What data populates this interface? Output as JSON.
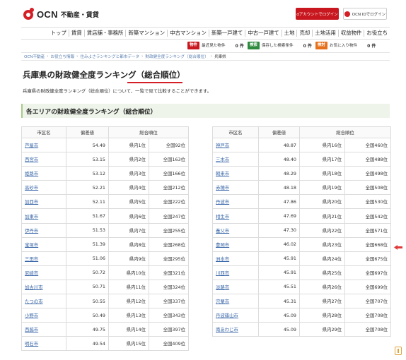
{
  "header": {
    "logo_text": "OCN",
    "logo_sub": "不動産・賃貸",
    "login_d": "dアカウントでログイン",
    "login_ocn": "OCN IDでログイン"
  },
  "nav": [
    "トップ",
    "賃貸",
    "賃店舗・事務所",
    "新築マンション",
    "中古マンション",
    "新築一戸建て",
    "中古一戸建て",
    "土地",
    "売却",
    "土地活用",
    "収益物件",
    "お役立ち"
  ],
  "tools": [
    {
      "tag": "物件",
      "label": "最近見た物件",
      "count": "0 件",
      "color": "#c8171e"
    },
    {
      "tag": "検索",
      "label": "保存した検索条件",
      "count": "0 件",
      "color": "#2e8b3e"
    },
    {
      "tag": "検討",
      "label": "お気に入り物件",
      "count": "0 件",
      "color": "#e7711b"
    }
  ],
  "breadcrumb": [
    "OCN不動産",
    "お役立ち情報",
    "住みよさランキングと都市データ",
    "財政健全度ランキング（総合順位）",
    "兵庫県"
  ],
  "page_title": "兵庫県の財政健全度ランキング（総合順位）",
  "lead": "兵庫県の財政健全度ランキング（総合順位）について、一覧で見て比較することができます。",
  "section_title": "各エリアの財政健全度ランキング（総合順位）",
  "table_headers": {
    "city": "市区名",
    "dev": "偏差値",
    "rank": "総合順位"
  },
  "left_rows": [
    {
      "city": "芦屋市",
      "dev": "54.49",
      "pref": "県内1位",
      "nat": "全国92位"
    },
    {
      "city": "西宮市",
      "dev": "53.15",
      "pref": "県内2位",
      "nat": "全国163位"
    },
    {
      "city": "姫路市",
      "dev": "53.12",
      "pref": "県内3位",
      "nat": "全国166位"
    },
    {
      "city": "高砂市",
      "dev": "52.21",
      "pref": "県内4位",
      "nat": "全国212位"
    },
    {
      "city": "加西市",
      "dev": "52.11",
      "pref": "県内5位",
      "nat": "全国222位"
    },
    {
      "city": "加東市",
      "dev": "51.67",
      "pref": "県内6位",
      "nat": "全国247位"
    },
    {
      "city": "伊丹市",
      "dev": "51.53",
      "pref": "県内7位",
      "nat": "全国255位"
    },
    {
      "city": "宝塚市",
      "dev": "51.39",
      "pref": "県内8位",
      "nat": "全国268位"
    },
    {
      "city": "三田市",
      "dev": "51.06",
      "pref": "県内9位",
      "nat": "全国295位"
    },
    {
      "city": "尼崎市",
      "dev": "50.72",
      "pref": "県内10位",
      "nat": "全国321位"
    },
    {
      "city": "加古川市",
      "dev": "50.71",
      "pref": "県内11位",
      "nat": "全国324位"
    },
    {
      "city": "たつの市",
      "dev": "50.55",
      "pref": "県内12位",
      "nat": "全国337位"
    },
    {
      "city": "小野市",
      "dev": "50.49",
      "pref": "県内13位",
      "nat": "全国343位"
    },
    {
      "city": "西脇市",
      "dev": "49.75",
      "pref": "県内14位",
      "nat": "全国397位"
    },
    {
      "city": "明石市",
      "dev": "49.54",
      "pref": "県内15位",
      "nat": "全国409位"
    }
  ],
  "right_rows": [
    {
      "city": "神戸市",
      "dev": "48.87",
      "pref": "県内16位",
      "nat": "全国460位"
    },
    {
      "city": "三木市",
      "dev": "48.40",
      "pref": "県内17位",
      "nat": "全国488位"
    },
    {
      "city": "朝来市",
      "dev": "48.29",
      "pref": "県内18位",
      "nat": "全国498位"
    },
    {
      "city": "赤穂市",
      "dev": "48.18",
      "pref": "県内19位",
      "nat": "全国508位"
    },
    {
      "city": "丹波市",
      "dev": "47.86",
      "pref": "県内20位",
      "nat": "全国530位"
    },
    {
      "city": "相生市",
      "dev": "47.69",
      "pref": "県内21位",
      "nat": "全国542位"
    },
    {
      "city": "養父市",
      "dev": "47.30",
      "pref": "県内22位",
      "nat": "全国571位"
    },
    {
      "city": "豊岡市",
      "dev": "46.02",
      "pref": "県内23位",
      "nat": "全国668位"
    },
    {
      "city": "洲本市",
      "dev": "45.91",
      "pref": "県内24位",
      "nat": "全国675位"
    },
    {
      "city": "川西市",
      "dev": "45.91",
      "pref": "県内25位",
      "nat": "全国697位"
    },
    {
      "city": "淡路市",
      "dev": "45.51",
      "pref": "県内26位",
      "nat": "全国699位"
    },
    {
      "city": "宍粟市",
      "dev": "45.31",
      "pref": "県内27位",
      "nat": "全国707位"
    },
    {
      "city": "丹波篠山市",
      "dev": "45.09",
      "pref": "県内28位",
      "nat": "全国708位"
    },
    {
      "city": "南あわじ市",
      "dev": "45.09",
      "pref": "県内29位",
      "nat": "全国708位"
    }
  ],
  "colors": {
    "brand_red": "#c8171e",
    "link": "#3a67a8",
    "section_bg": "#eef4e9"
  }
}
